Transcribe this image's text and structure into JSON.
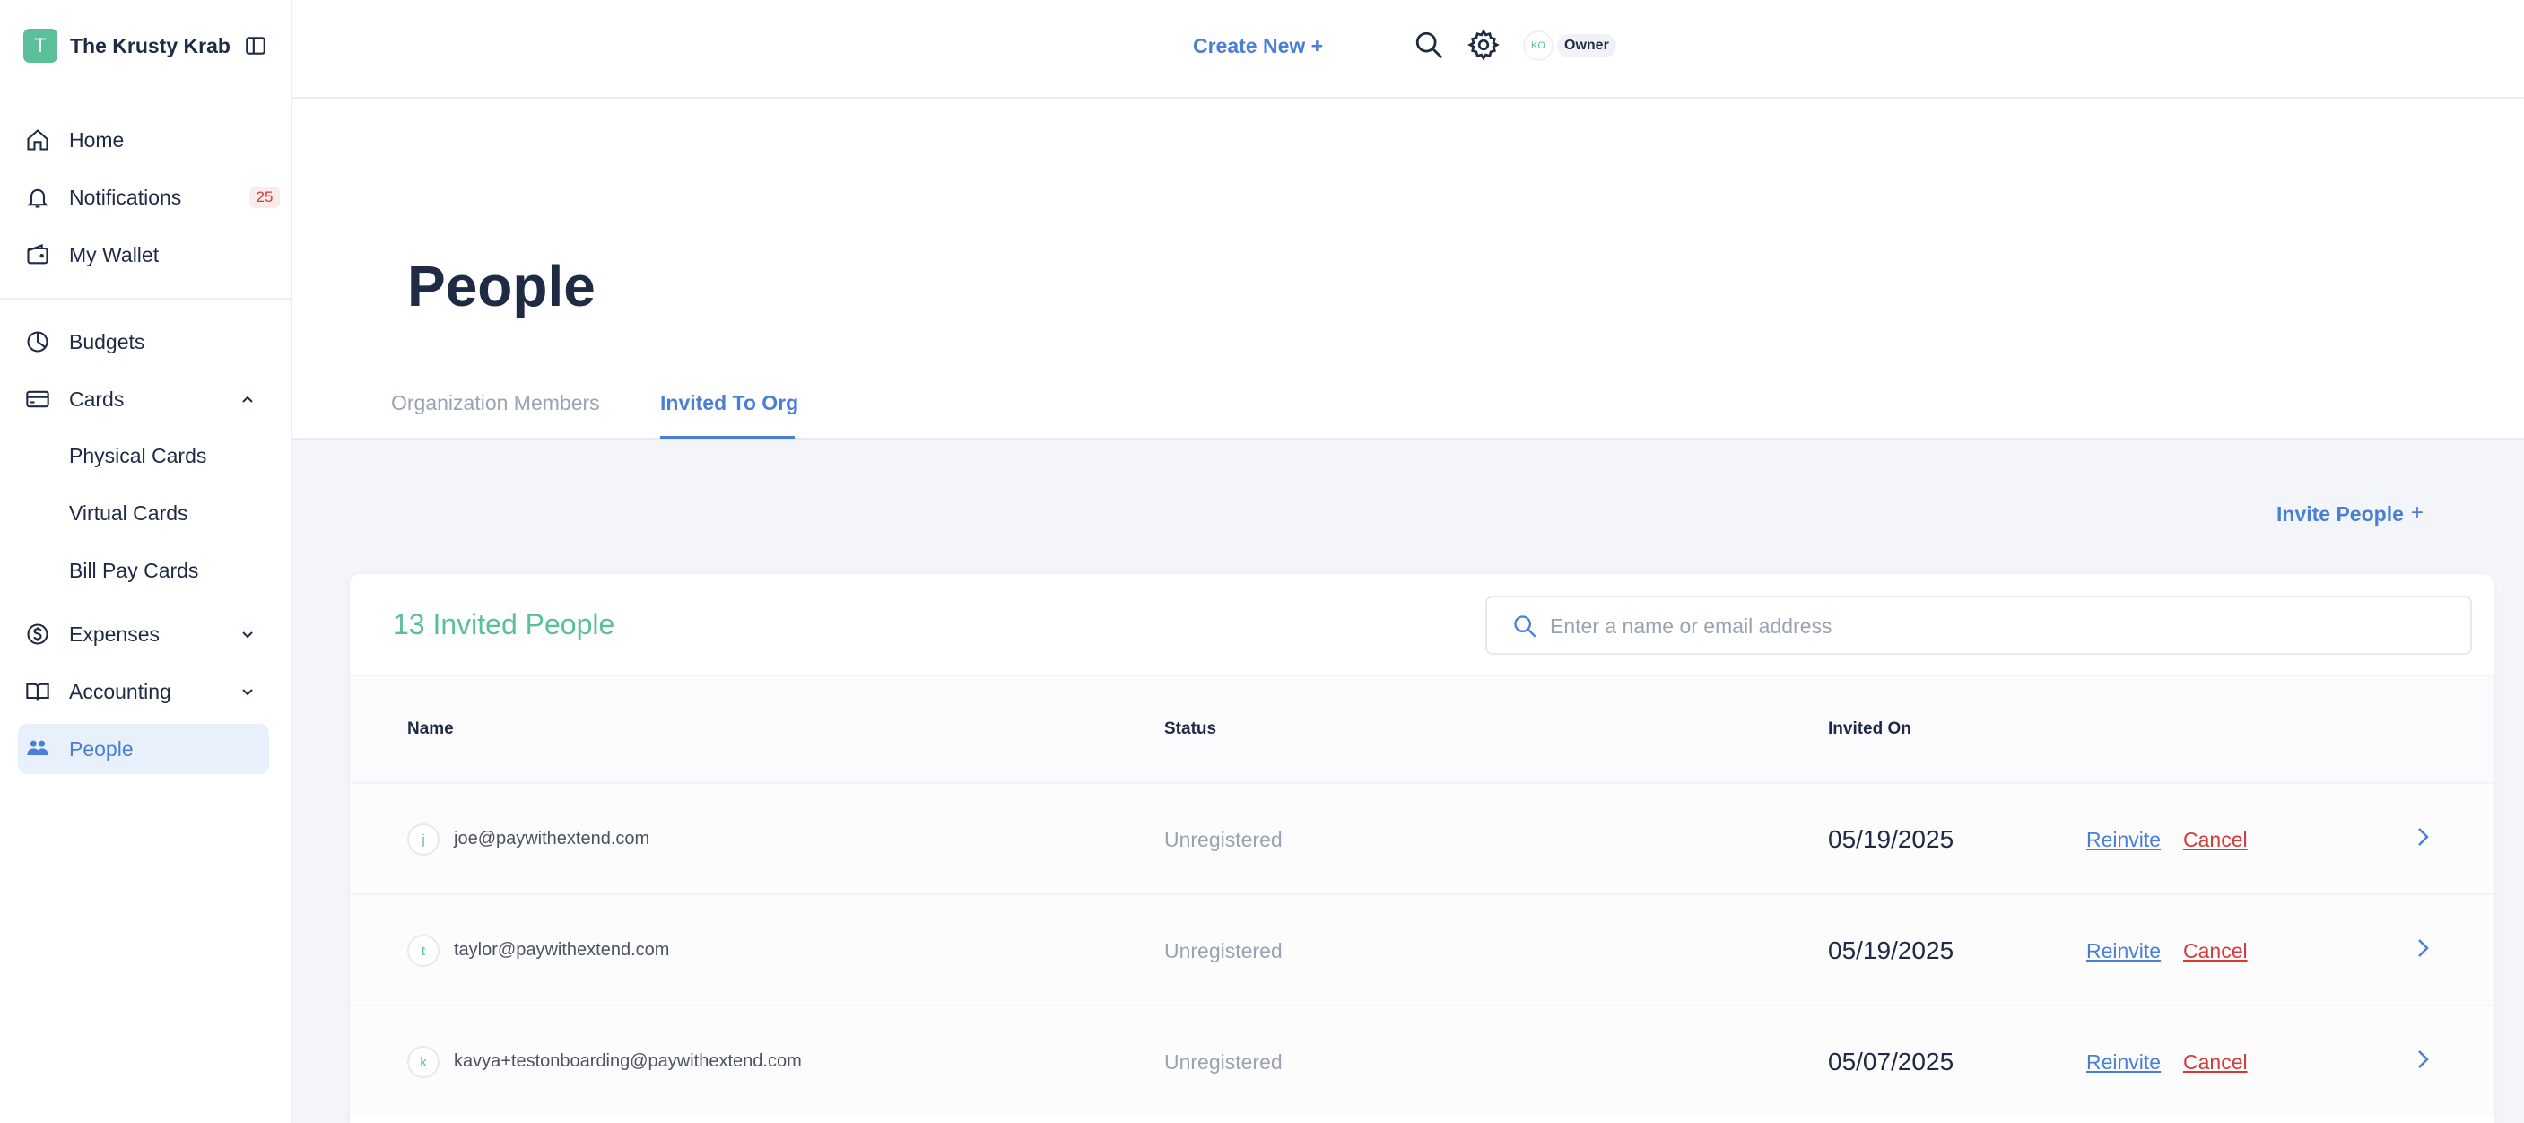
{
  "org": {
    "initial": "T",
    "name": "The Krusty Krab"
  },
  "nav": {
    "home": "Home",
    "notifications": "Notifications",
    "notifications_count": "25",
    "wallet": "My Wallet",
    "budgets": "Budgets",
    "cards": "Cards",
    "physical_cards": "Physical Cards",
    "virtual_cards": "Virtual Cards",
    "bill_pay_cards": "Bill Pay Cards",
    "expenses": "Expenses",
    "accounting": "Accounting",
    "people": "People"
  },
  "topbar": {
    "create_new": "Create New +",
    "user_initials": "KO",
    "role": "Owner"
  },
  "page": {
    "title": "People",
    "tabs": [
      {
        "label": "Organization Members",
        "active": false
      },
      {
        "label": "Invited To Org",
        "active": true
      }
    ],
    "invite_label": "Invite People",
    "invite_plus": "+"
  },
  "invited": {
    "title": "13 Invited People",
    "search_placeholder": "Enter a name or email address",
    "columns": {
      "name": "Name",
      "status": "Status",
      "invited_on": "Invited On"
    },
    "reinvite_label": "Reinvite",
    "cancel_label": "Cancel",
    "rows": [
      {
        "initial": "j",
        "email": "joe@paywithextend.com",
        "status": "Unregistered",
        "date": "05/19/2025"
      },
      {
        "initial": "t",
        "email": "taylor@paywithextend.com",
        "status": "Unregistered",
        "date": "05/19/2025"
      },
      {
        "initial": "k",
        "email": "kavya+testonboarding@paywithextend.com",
        "status": "Unregistered",
        "date": "05/07/2025"
      }
    ]
  },
  "colors": {
    "accent": "#4a7fd8",
    "brand_green": "#5bbf9a",
    "danger": "#d43a3a"
  }
}
